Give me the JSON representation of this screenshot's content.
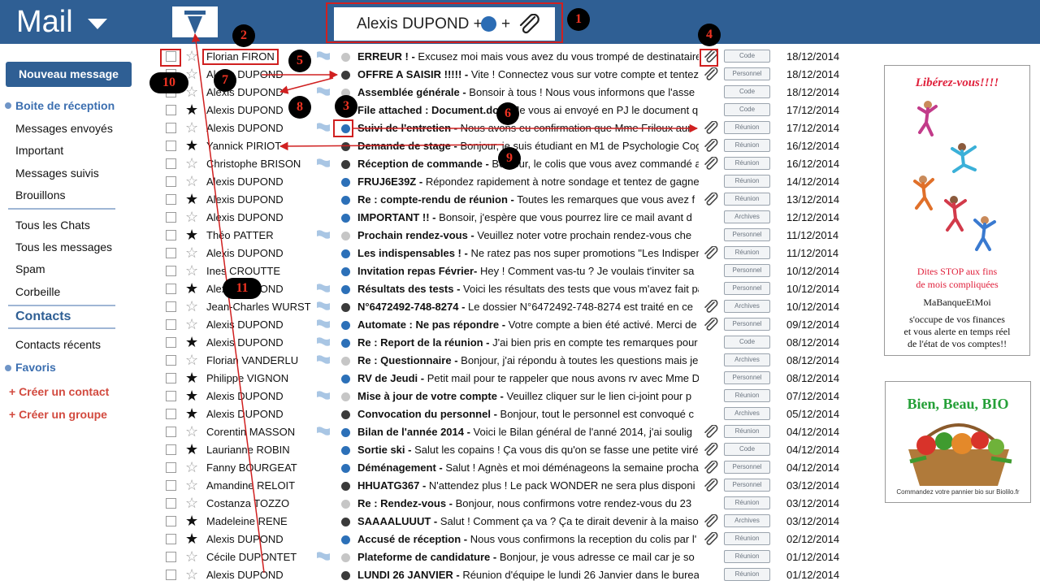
{
  "app": {
    "title": "Mail"
  },
  "filter": {
    "text": "Alexis DUPOND + ",
    "plus2": "+"
  },
  "sidebar": {
    "new_message": "Nouveau message",
    "inbox": "Boite de réception",
    "sent": "Messages envoyés",
    "important": "Important",
    "followed": "Messages suivis",
    "drafts": "Brouillons",
    "chats": "Tous les Chats",
    "all_messages": "Tous les messages",
    "spam": "Spam",
    "trash": "Corbeille",
    "contacts_heading": "Contacts",
    "recent_contacts": "Contacts récents",
    "favorites": "Favoris",
    "create_contact": "+ Créer un contact",
    "create_group": "+ Créer un groupe"
  },
  "mails": [
    {
      "sender": "Florian FIRON",
      "star": false,
      "flag": true,
      "dot": "grey",
      "subject": "ERREUR ! -",
      "preview": " Excusez moi mais vous avez du vous trompé de destinataire",
      "clip": true,
      "tag": "Code",
      "date": "18/12/2014"
    },
    {
      "sender": "Alexis DUPOND",
      "star": false,
      "flag": false,
      "dot": "dark",
      "subject": "OFFRE A SAISIR !!!!! -",
      "preview": " Vite ! Connectez vous sur votre compte et tentez",
      "clip": true,
      "tag": "Personnel",
      "date": "18/12/2014"
    },
    {
      "sender": "Alexis DUPOND",
      "star": false,
      "flag": true,
      "dot": "grey",
      "subject": "Assemblée générale -",
      "preview": " Bonsoir à tous ! Nous vous informons que l'asse",
      "clip": false,
      "tag": "Code",
      "date": "18/12/2014"
    },
    {
      "sender": "Alexis DUPOND",
      "star": true,
      "flag": false,
      "dot": "grey",
      "subject": "File attached : Document.doc -",
      "preview": " Je vous ai envoyé en PJ le document q",
      "clip": false,
      "tag": "Code",
      "date": "17/12/2014"
    },
    {
      "sender": "Alexis DUPOND",
      "star": false,
      "flag": true,
      "dot": "blue",
      "subject": "Suivi de l'entretien -",
      "preview": " Nous avons eu confirmation que Mme Friloux aur",
      "clip": true,
      "tag": "Réunion",
      "date": "17/12/2014"
    },
    {
      "sender": "Yannick PIRIOT",
      "star": true,
      "flag": false,
      "dot": "dark",
      "subject": "Demande de stage -",
      "preview": " Bonjour, je suis étudiant en M1 de Psychologie Cog",
      "clip": true,
      "tag": "Réunion",
      "date": "16/12/2014"
    },
    {
      "sender": "Christophe BRISON",
      "star": false,
      "flag": true,
      "dot": "dark",
      "subject": "Réception de commande -",
      "preview": " Bonjour, le colis que vous avez commandé a",
      "clip": true,
      "tag": "Réunion",
      "date": "16/12/2014"
    },
    {
      "sender": "Alexis DUPOND",
      "star": false,
      "flag": false,
      "dot": "blue",
      "subject": "FRUJ6E39Z -",
      "preview": " Répondez rapidement à notre sondage et tentez de gagner",
      "clip": false,
      "tag": "Réunion",
      "date": "14/12/2014"
    },
    {
      "sender": "Alexis DUPOND",
      "star": true,
      "flag": false,
      "dot": "blue",
      "subject": "Re : compte-rendu de réunion -",
      "preview": "  Toutes les remarques que vous avez f",
      "clip": true,
      "tag": "Réunion",
      "date": "13/12/2014"
    },
    {
      "sender": "Alexis DUPOND",
      "star": false,
      "flag": false,
      "dot": "blue",
      "subject": "IMPORTANT !! -",
      "preview": " Bonsoir, j'espère que vous pourrez lire ce mail avant d",
      "clip": false,
      "tag": "Archives",
      "date": "12/12/2014"
    },
    {
      "sender": "Théo PATTER",
      "star": true,
      "flag": true,
      "dot": "grey",
      "subject": "Prochain rendez-vous -",
      "preview": " Veuillez noter votre prochain rendez-vous che",
      "clip": false,
      "tag": "Personnel",
      "date": "11/12/2014"
    },
    {
      "sender": "Alexis DUPOND",
      "star": false,
      "flag": false,
      "dot": "blue",
      "subject": "Les indispensables ! -",
      "preview": " Ne ratez pas nos super promotions \"Les Indispen",
      "clip": true,
      "tag": "Réunion",
      "date": "11/12/2014"
    },
    {
      "sender": "Ines CROUTTE",
      "star": false,
      "flag": false,
      "dot": "blue",
      "subject": "Invitation repas Février-",
      "preview": " Hey ! Comment vas-tu ? Je voulais t'inviter sa",
      "clip": false,
      "tag": "Personnel",
      "date": "10/12/2014"
    },
    {
      "sender": "Alexis DUPOND",
      "star": true,
      "flag": true,
      "dot": "blue",
      "subject": "Résultats des tests -",
      "preview": " Voici les résultats des tests que vous m'avez fait pa",
      "clip": false,
      "tag": "Personnel",
      "date": "10/12/2014"
    },
    {
      "sender": "Jean-Charles WURST",
      "star": false,
      "flag": true,
      "dot": "dark",
      "subject": "N°6472492-748-8274 -",
      "preview": " Le dossier N°6472492-748-8274 est traité en ce",
      "clip": true,
      "tag": "Archives",
      "date": "10/12/2014"
    },
    {
      "sender": "Alexis DUPOND",
      "star": false,
      "flag": true,
      "dot": "blue",
      "subject": "Automate : Ne pas répondre -",
      "preview": " Votre compte a bien été activé. Merci de",
      "clip": true,
      "tag": "Personnel",
      "date": "09/12/2014"
    },
    {
      "sender": "Alexis DUPOND",
      "star": true,
      "flag": true,
      "dot": "blue",
      "subject": "Re : Report de la réunion -",
      "preview": " J'ai bien pris en compte tes remarques pour",
      "clip": false,
      "tag": "Code",
      "date": "08/12/2014"
    },
    {
      "sender": "Florian VANDERLU",
      "star": false,
      "flag": true,
      "dot": "grey",
      "subject": "Re : Questionnaire -",
      "preview": " Bonjour, j'ai répondu à toutes les questions mais je",
      "clip": false,
      "tag": "Archives",
      "date": "08/12/2014"
    },
    {
      "sender": "Philippe VIGNON",
      "star": true,
      "flag": false,
      "dot": "blue",
      "subject": "RV de Jeudi -",
      "preview": " Petit mail pour te rappeler que nous avons rv avec Mme D",
      "clip": false,
      "tag": "Personnel",
      "date": "08/12/2014"
    },
    {
      "sender": "Alexis DUPOND",
      "star": true,
      "flag": true,
      "dot": "grey",
      "subject": "Mise à jour de votre compte -",
      "preview": " Veuillez cliquer sur le lien ci-joint pour p",
      "clip": false,
      "tag": "Réunion",
      "date": "07/12/2014"
    },
    {
      "sender": "Alexis DUPOND",
      "star": true,
      "flag": false,
      "dot": "dark",
      "subject": "Convocation du personnel -",
      "preview": " Bonjour, tout le personnel est convoqué c",
      "clip": false,
      "tag": "Archives",
      "date": "05/12/2014"
    },
    {
      "sender": "Corentin MASSON",
      "star": false,
      "flag": true,
      "dot": "blue",
      "subject": "Bilan de l'année 2014 -",
      "preview": " Voici le Bilan général de l'anné 2014, j'ai soulig",
      "clip": true,
      "tag": "Réunion",
      "date": "04/12/2014"
    },
    {
      "sender": "Laurianne ROBIN",
      "star": true,
      "flag": false,
      "dot": "blue",
      "subject": "Sortie ski -",
      "preview": " Salut les copains ! Ça vous dis qu'on se fasse une petite virée",
      "clip": true,
      "tag": "Code",
      "date": "04/12/2014"
    },
    {
      "sender": "Fanny BOURGEAT",
      "star": false,
      "flag": false,
      "dot": "blue",
      "subject": "Déménagement -",
      "preview": " Salut ! Agnès et moi déménageons la semaine prochai",
      "clip": true,
      "tag": "Personnel",
      "date": "04/12/2014"
    },
    {
      "sender": "Amandine RELOIT",
      "star": false,
      "flag": false,
      "dot": "dark",
      "subject": "HHUATG367 -",
      "preview": " N'attendez plus ! Le pack WONDER ne sera plus disponi",
      "clip": true,
      "tag": "Personnel",
      "date": "03/12/2014"
    },
    {
      "sender": "Costanza TOZZO",
      "star": false,
      "flag": false,
      "dot": "grey",
      "subject": "Re : Rendez-vous -",
      "preview": " Bonjour, nous confirmons votre rendez-vous du 23",
      "clip": false,
      "tag": "Réunion",
      "date": "03/12/2014"
    },
    {
      "sender": "Madeleine RENE",
      "star": true,
      "flag": false,
      "dot": "dark",
      "subject": "SAAAALUUUT -",
      "preview": " Salut ! Comment ça va ? Ça te dirait devenir à la maison",
      "clip": true,
      "tag": "Archives",
      "date": "03/12/2014"
    },
    {
      "sender": "Alexis DUPOND",
      "star": true,
      "flag": false,
      "dot": "blue",
      "subject": "Accusé de réception -",
      "preview": " Nous vous confirmons la reception du colis par l'",
      "clip": true,
      "tag": "Réunion",
      "date": "02/12/2014"
    },
    {
      "sender": "Cécile DUPONTET",
      "star": false,
      "flag": true,
      "dot": "grey",
      "subject": "Plateforme de candidature -",
      "preview": " Bonjour, je vous adresse ce mail car je so",
      "clip": false,
      "tag": "Réunion",
      "date": "01/12/2014"
    },
    {
      "sender": "Alexis DUPOND",
      "star": false,
      "flag": false,
      "dot": "dark",
      "subject": "LUNDI 26 JANVIER -",
      "preview": " Réunion d'équipe le lundi 26 Janvier dans le burea",
      "clip": false,
      "tag": "Réunion",
      "date": "01/12/2014"
    }
  ],
  "markers": [
    "1",
    "2",
    "3",
    "4",
    "5",
    "6",
    "7",
    "8",
    "9",
    "10",
    "11"
  ],
  "ads": {
    "ad1": {
      "title": "Libérez-vous!!!!",
      "line1": "Dites STOP aux fins",
      "line2": "de mois compliquées",
      "brand": "MaBanqueEtMoi",
      "line3": "s'occupe de vos finances",
      "line4": "et vous alerte en temps réel",
      "line5": "de l'état de vos comptes!!"
    },
    "ad2": {
      "title": "Bien, Beau, BIO",
      "footer": "Commandez votre pannier bio sur Biolilo.fr"
    }
  },
  "colors": {
    "header": "#2f5f94",
    "accent": "#3c6fb0",
    "annotation": "#d02020"
  },
  "icons": [
    "trash-icon",
    "paperclip-icon",
    "star-icon",
    "flag-icon",
    "chevron-down-icon"
  ]
}
